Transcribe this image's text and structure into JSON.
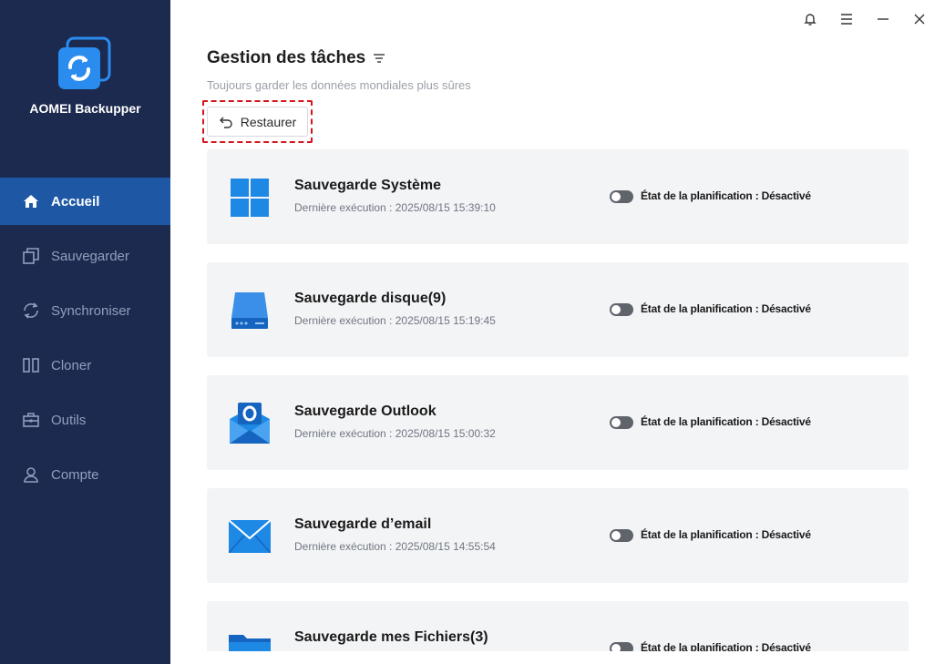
{
  "app": {
    "name": "AOMEI Backupper"
  },
  "sidebar": {
    "items": [
      {
        "label": "Accueil",
        "icon": "home-icon",
        "active": true
      },
      {
        "label": "Sauvegarder",
        "icon": "backup-icon",
        "active": false
      },
      {
        "label": "Synchroniser",
        "icon": "sync-icon",
        "active": false
      },
      {
        "label": "Cloner",
        "icon": "clone-icon",
        "active": false
      },
      {
        "label": "Outils",
        "icon": "tools-icon",
        "active": false
      },
      {
        "label": "Compte",
        "icon": "account-icon",
        "active": false
      }
    ]
  },
  "window_controls": [
    "bell-icon",
    "menu-icon",
    "minimize-icon",
    "close-icon"
  ],
  "main": {
    "title": "Gestion des tâches",
    "subtitle": "Toujours garder les données mondiales plus sûres",
    "restore_label": "Restaurer"
  },
  "tasks": [
    {
      "name": "Sauvegarde Système",
      "last_run": "Dernière exécution : 2025/08/15 15:39:10",
      "schedule": "État de la planification : Désactivé",
      "icon": "windows-icon"
    },
    {
      "name": "Sauvegarde disque(9)",
      "last_run": "Dernière exécution : 2025/08/15 15:19:45",
      "schedule": "État de la planification : Désactivé",
      "icon": "disk-icon"
    },
    {
      "name": "Sauvegarde Outlook",
      "last_run": "Dernière exécution : 2025/08/15 15:00:32",
      "schedule": "État de la planification : Désactivé",
      "icon": "outlook-icon"
    },
    {
      "name": "Sauvegarde d’email",
      "last_run": "Dernière exécution : 2025/08/15 14:55:54",
      "schedule": "État de la planification : Désactivé",
      "icon": "email-icon"
    },
    {
      "name": "Sauvegarde mes Fichiers(3)",
      "last_run": "",
      "schedule": "État de la planification : Désactivé",
      "icon": "folder-icon"
    }
  ],
  "colors": {
    "sidebar_bg": "#1b2a4e",
    "active_nav": "#1e58a5",
    "accent": "#1e88e5",
    "highlight": "#d6141b"
  }
}
